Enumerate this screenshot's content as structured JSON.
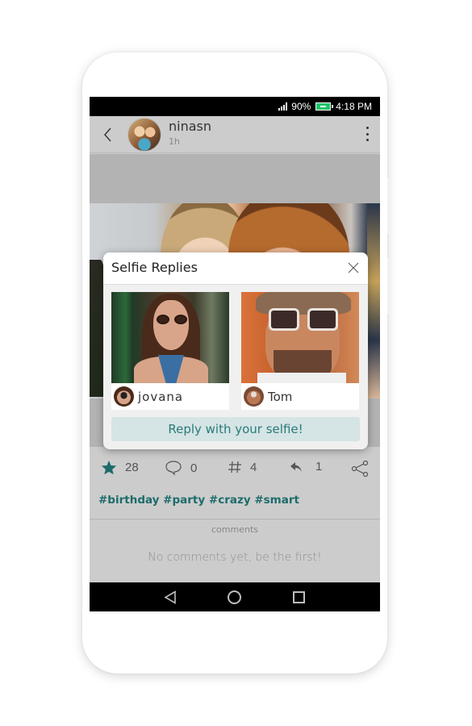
{
  "status_bar": {
    "battery": "90%",
    "time": "4:18 PM"
  },
  "post": {
    "username": "ninasn",
    "time_ago": "1h",
    "stats": {
      "likes": "28",
      "comments": "0",
      "hashtags": "4",
      "replies": "1"
    },
    "hashtags": "#birthday #party #crazy #smart",
    "comments_label": "comments",
    "no_comments_text": "No comments yet, be the first!"
  },
  "modal": {
    "title": "Selfie Replies",
    "replies": [
      {
        "name": "jovana"
      },
      {
        "name": "Tom"
      }
    ],
    "reply_button": "Reply with your selfie!"
  },
  "colors": {
    "accent": "#1e6b6b",
    "reply_button_bg": "#d5e4e4",
    "battery": "#21c46a"
  }
}
